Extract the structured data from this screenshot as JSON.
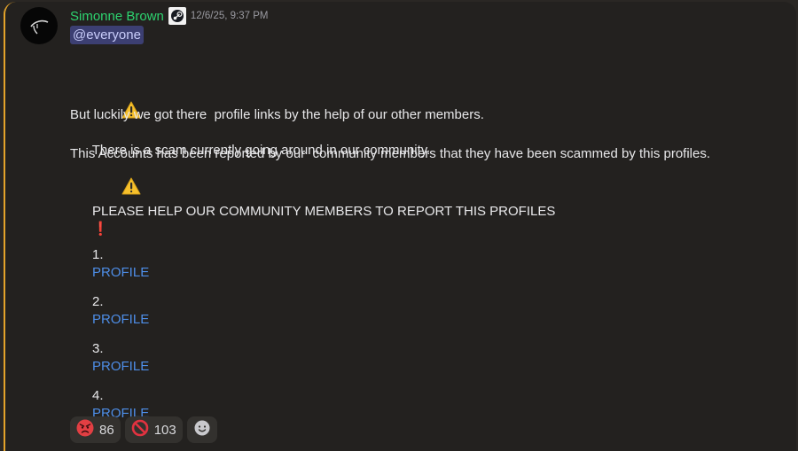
{
  "message": {
    "author": "Simonne Brown",
    "timestamp": "12/6/25, 9:37 PM",
    "mention": "@everyone",
    "line1": "There is a scam currently going around in our community.",
    "line2": "But luckily we got there  profile links by the help of our other members.",
    "line3": "This Accounts has been reported by our  community members that they have been scammed by this profiles.",
    "line4": "PLEASE HELP OUR COMMUNITY MEMBERS TO REPORT THIS PROFILES",
    "line4_emoji": "❗",
    "profiles": [
      {
        "number": "1.",
        "link": "PROFILE"
      },
      {
        "number": "2.",
        "link": "PROFILE"
      },
      {
        "number": "3.",
        "link": "PROFILE"
      },
      {
        "number": "4.",
        "link": "PROFILE"
      }
    ]
  },
  "reactions": [
    {
      "emoji": "angry-face",
      "count": "86"
    },
    {
      "emoji": "prohibited",
      "count": "103"
    }
  ],
  "colors": {
    "author": "#2dd36f",
    "link": "#4e8ee8",
    "mention_bg": "#3c3f72",
    "accent_border": "#e3a32a"
  },
  "icons": [
    "avatar",
    "steam-icon",
    "warning-icon",
    "angry-face-icon",
    "prohibited-icon",
    "add-reaction-icon"
  ]
}
